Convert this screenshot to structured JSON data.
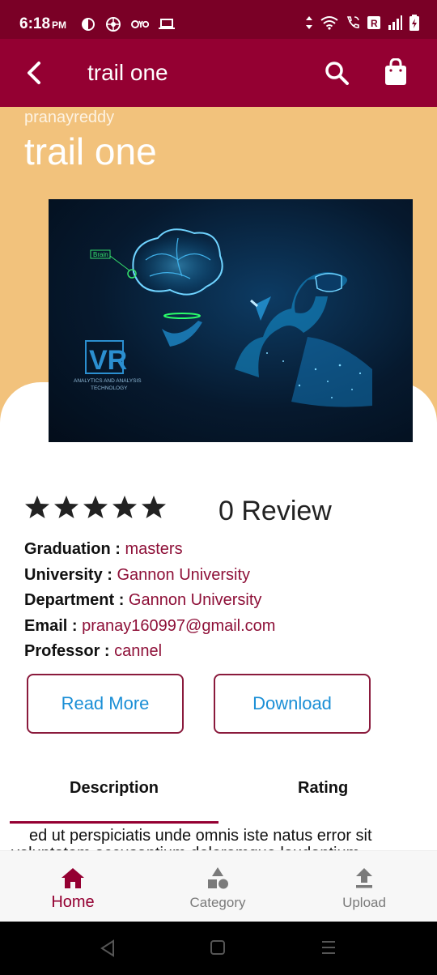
{
  "status_bar": {
    "time": "6:18",
    "ampm": "PM"
  },
  "app_bar": {
    "title": "trail one"
  },
  "hero": {
    "author": "pranayreddy",
    "title": "trail one"
  },
  "cover_image": {
    "brain_label": "Brain",
    "vr_mark": "VR",
    "caption_line1": "ANALYTICS AND ANALYSIS",
    "caption_line2": "TECHNOLOGY"
  },
  "rating": {
    "stars": 5,
    "review_text": "0 Review"
  },
  "details": [
    {
      "key": "Graduation : ",
      "value": "masters"
    },
    {
      "key": "University : ",
      "value": "Gannon University"
    },
    {
      "key": "Department : ",
      "value": "Gannon University"
    },
    {
      "key": "Email : ",
      "value": "pranay160997@gmail.com"
    },
    {
      "key": "Professor : ",
      "value": "cannel"
    }
  ],
  "buttons": {
    "read_more": "Read More",
    "download": "Download"
  },
  "tabs": {
    "description": "Description",
    "rating": "Rating",
    "active": "description"
  },
  "description": {
    "line1": "ed ut perspiciatis unde omnis iste natus error sit",
    "line2": "voluptatem accusantium doloremque laudantium"
  },
  "bottom_nav": [
    {
      "label": "Home",
      "icon": "home-icon",
      "active": true
    },
    {
      "label": "Category",
      "icon": "category-icon",
      "active": false
    },
    {
      "label": "Upload",
      "icon": "upload-icon",
      "active": false
    }
  ],
  "colors": {
    "primary": "#940032",
    "status_bar": "#7a0026",
    "hero_bg": "#f2c27c",
    "button_text": "#1b8fd6"
  }
}
